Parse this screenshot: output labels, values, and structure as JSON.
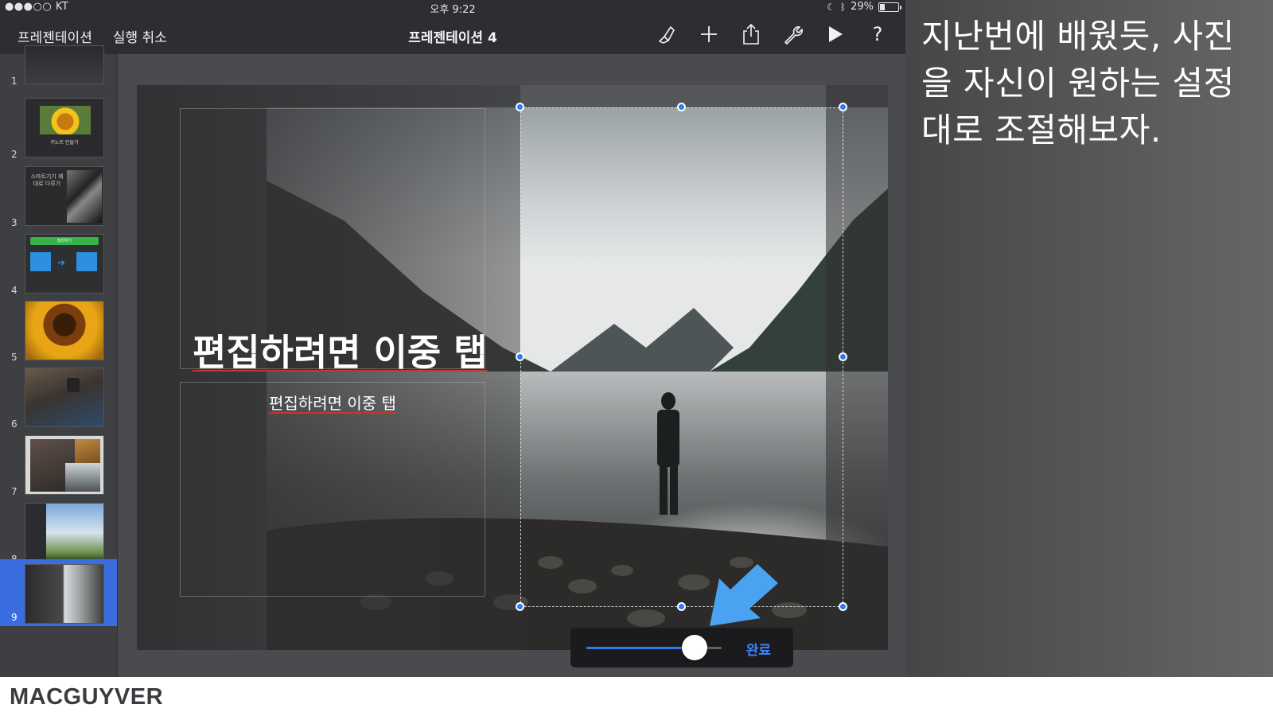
{
  "status_bar": {
    "carrier": "●●●○○ KT",
    "time": "오후 9:22",
    "battery_percent": "29%",
    "battery_level": 0.29
  },
  "toolbar": {
    "presentations_label": "프레젠테이션",
    "undo_label": "실행 취소",
    "document_title": "프레젠테이션 4",
    "icons": [
      "brush-icon",
      "plus-icon",
      "share-icon",
      "wrench-icon",
      "play-icon",
      "help-icon"
    ]
  },
  "navigator": {
    "slides": [
      {
        "number": "1",
        "thumb_text": ""
      },
      {
        "number": "2",
        "thumb_text": "키노트 만들기"
      },
      {
        "number": "3",
        "thumb_text": "스마트기기 제대로 다루기"
      },
      {
        "number": "4",
        "thumb_text": "정리하기"
      },
      {
        "number": "5",
        "thumb_text": ""
      },
      {
        "number": "6",
        "thumb_text": ""
      },
      {
        "number": "7",
        "thumb_text": ""
      },
      {
        "number": "8",
        "thumb_text": ""
      },
      {
        "number": "9",
        "thumb_text": ""
      }
    ],
    "selected_slide": "9",
    "add_slide_label": "+"
  },
  "slide": {
    "title_placeholder": "편집하려면 이중 탭",
    "body_placeholder": "편집하려면 이중 탭"
  },
  "mask_control": {
    "slider_value": 0.8,
    "done_label": "완료"
  },
  "annotation": {
    "text": "지난번에 배웠듯, 사진을 자신이 원하는 설정대로 조절해보자."
  },
  "footer": {
    "brand": "MACGUYVER"
  },
  "colors": {
    "accent": "#2e7bf0",
    "selected_row": "#3a6ee0",
    "arrow": "#4aa3f0"
  }
}
